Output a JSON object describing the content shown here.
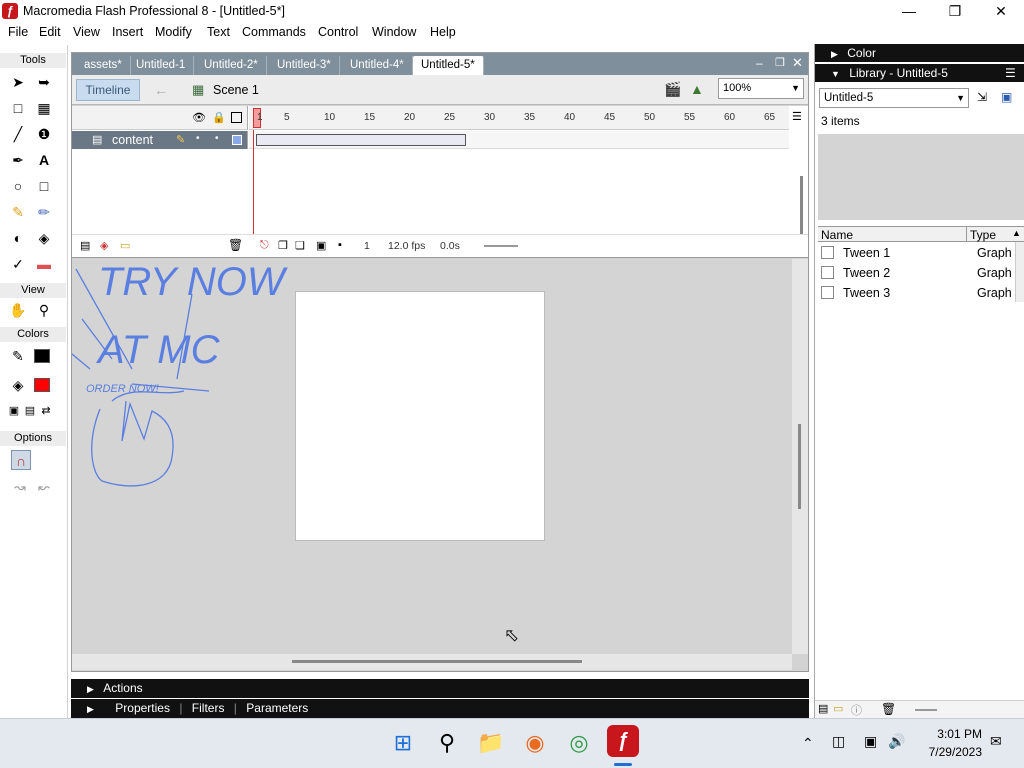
{
  "window": {
    "title": "Macromedia Flash Professional 8 - [Untitled-5*]",
    "app_icon": "ƒ"
  },
  "menu": [
    "File",
    "Edit",
    "View",
    "Insert",
    "Modify",
    "Text",
    "Commands",
    "Control",
    "Window",
    "Help"
  ],
  "tools": {
    "header": "Tools",
    "view_header": "View",
    "colors_header": "Colors",
    "options_header": "Options",
    "stroke_color": "#000000",
    "fill_color": "#ff0000"
  },
  "document": {
    "tabs": [
      "assets*",
      "Untitled-1",
      "Untitled-2*",
      "Untitled-3*",
      "Untitled-4*",
      "Untitled-5*"
    ],
    "active_tab": "Untitled-5*",
    "timeline_button": "Timeline",
    "scene_label": "Scene 1",
    "zoom": "100%"
  },
  "timeline": {
    "layer_name": "content",
    "ruler_ticks": [
      "1",
      "5",
      "10",
      "15",
      "20",
      "25",
      "30",
      "35",
      "40",
      "45",
      "50",
      "55",
      "60",
      "65"
    ],
    "current_frame": "1",
    "frame_rate": "12.0 fps",
    "elapsed": "0.0s"
  },
  "pasteboard": {
    "line1": "TRY NOW",
    "line2": "AT MC",
    "line3": "ORDER NOW!",
    "ink_color": "#5b7fe0"
  },
  "bottom_panels": {
    "actions": "Actions",
    "properties": "Properties",
    "filters": "Filters",
    "parameters": "Parameters"
  },
  "right_panels": {
    "color_panel": "Color",
    "library_panel": "Library - Untitled-5",
    "library_select": "Untitled-5",
    "item_count": "3 items",
    "col_name": "Name",
    "col_type": "Type",
    "items": [
      {
        "name": "Tween 1",
        "type": "Graph"
      },
      {
        "name": "Tween 2",
        "type": "Graph"
      },
      {
        "name": "Tween 3",
        "type": "Graph"
      }
    ]
  },
  "taskbar": {
    "time": "3:01 PM",
    "date": "7/29/2023"
  }
}
